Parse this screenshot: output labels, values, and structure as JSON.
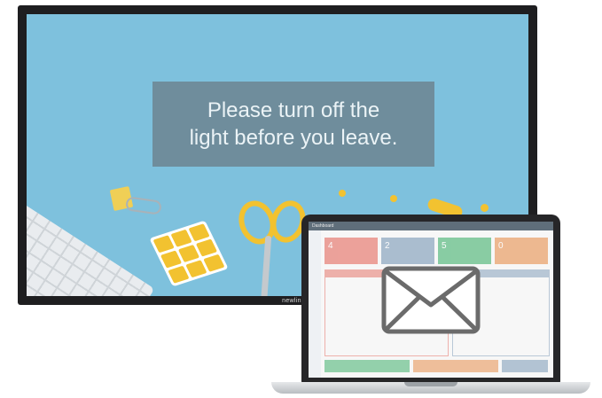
{
  "display": {
    "message_lines": [
      "Please turn off the",
      "light before you leave."
    ],
    "brand": "newline"
  },
  "laptop": {
    "app_title": "Dashboard",
    "tiles": [
      {
        "value": "4",
        "color": "#e35b4f"
      },
      {
        "value": "2",
        "color": "#6d8fb0"
      },
      {
        "value": "5",
        "color": "#2faa5f"
      },
      {
        "value": "0",
        "color": "#e5863d"
      }
    ],
    "envelope_icon": "mail-envelope-icon"
  },
  "colors": {
    "screen_bg": "#7ec1dd",
    "message_box": "#6e8a98",
    "accent_yellow": "#f2c230"
  }
}
